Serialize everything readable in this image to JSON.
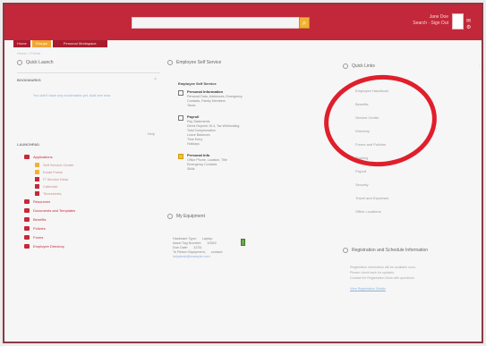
{
  "header": {
    "search_placeholder": "",
    "search_button": "⌕",
    "user_name": "Jane Doe",
    "user_sub": "Search · Sign Out",
    "header_icons": "✉ ⚙",
    "tabs": [
      {
        "label": "Home"
      },
      {
        "label": "Groups"
      },
      {
        "label": "Personal Workspace"
      }
    ],
    "breadcrumb": "Home > Portal"
  },
  "left": {
    "quick_launch_title": "Quick Launch",
    "bookmarks_title": "Bookmarks",
    "bookmarks_close": "×",
    "bookmarks_text": "You don't have any bookmarks yet. Add one now.",
    "bookmarks_link": "Help",
    "launcher_title": "Launchpad",
    "items": [
      {
        "label": "Applications",
        "sub": false,
        "color": "#c7283a"
      },
      {
        "label": "Self Service Center",
        "sub": true,
        "color": "#f1b234"
      },
      {
        "label": "Email Portal",
        "sub": true,
        "color": "#f1b234"
      },
      {
        "label": "IT Service Desk",
        "sub": true,
        "color": "#c7283a"
      },
      {
        "label": "Calendar",
        "sub": true,
        "color": "#c7283a"
      },
      {
        "label": "Timesheets",
        "sub": true,
        "color": "#c7283a"
      },
      {
        "label": "Resources",
        "sub": false,
        "color": "#c7283a"
      },
      {
        "label": "Documents and Templates",
        "sub": false,
        "color": "#c7283a"
      },
      {
        "label": "Benefits",
        "sub": false,
        "color": "#c7283a"
      },
      {
        "label": "Policies",
        "sub": false,
        "color": "#c7283a"
      },
      {
        "label": "Forms",
        "sub": false,
        "color": "#c7283a"
      },
      {
        "label": "Employee Directory",
        "sub": false,
        "color": "#c7283a"
      }
    ]
  },
  "middle": {
    "ess_title": "Employee Self Service",
    "ess_header": "Employee Self Service",
    "groups": [
      {
        "name": "Personal Information",
        "lines": [
          "Personal Data, Addresses, Emergency",
          "Contacts, Family Members",
          "Taxes"
        ],
        "gold": false
      },
      {
        "name": "Payroll",
        "lines": [
          "Pay Statements",
          "Direct Deposit, W-4, Tax Withholding",
          "Total Compensation",
          "Leave Balances",
          "Time Entry",
          "Holidays"
        ],
        "gold": false
      },
      {
        "name": "Personal Info",
        "lines": [
          "Office Phone, Location, Title",
          "Emergency Contacts",
          "Skills"
        ],
        "gold": true
      }
    ],
    "equip_title": "My Equipment",
    "equip_lines": [
      {
        "label": "Hardware Type:",
        "value": "Laptop"
      },
      {
        "label": "Asset Tag Number:",
        "value": "10542"
      },
      {
        "label": "Due Date:",
        "value": "12/31"
      },
      {
        "label": "To Return Equipment,",
        "value": "contact:"
      },
      {
        "label": "helpdesk@example.com",
        "value": ""
      }
    ]
  },
  "right": {
    "quick_links_title": "Quick Links",
    "links": [
      "Employee Handbook",
      "Benefits",
      "Service Center",
      "Directory",
      "Forms and Policies",
      "Training",
      "Payroll",
      "Security",
      "Travel and Expenses",
      "Office Locations"
    ],
    "registration_title": "Registration and Schedule Information",
    "reg_lines": [
      "Registration information will be available soon.",
      "Please check back for updates.",
      "Contact the Registration Desk with questions."
    ],
    "reg_link": "View Registration Details"
  }
}
